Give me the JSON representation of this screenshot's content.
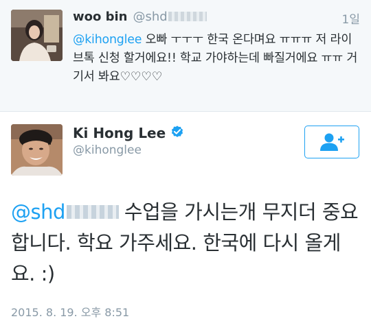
{
  "reply": {
    "name": "woo bin",
    "handle": "@shd",
    "time": "1일",
    "mention": "@kihonglee",
    "text": " 오빠 ㅜㅜㅜ 한국 온다며요 ㅠㅠㅠ 저 라이브톡 신청 할거에요!! 학교 가야하는데 빠질거에요 ㅠㅠ 거기서 봐요♡♡♡♡"
  },
  "tweet": {
    "name": "Ki Hong Lee",
    "handle": "@kihonglee",
    "mention": "@shd",
    "text": "수업을 가시는개 무지더 중요합니다. 학요 가주세요. 한국에 다시 올게요. :)",
    "timestamp": "2015. 8. 19. 오후 8:51"
  },
  "colors": {
    "accent": "#1da1f2",
    "muted": "#8899a6",
    "text": "#292f33",
    "reply_bg": "#f5f8fa"
  },
  "icons": {
    "verified": "verified-badge-icon",
    "follow": "follow-user-icon"
  }
}
